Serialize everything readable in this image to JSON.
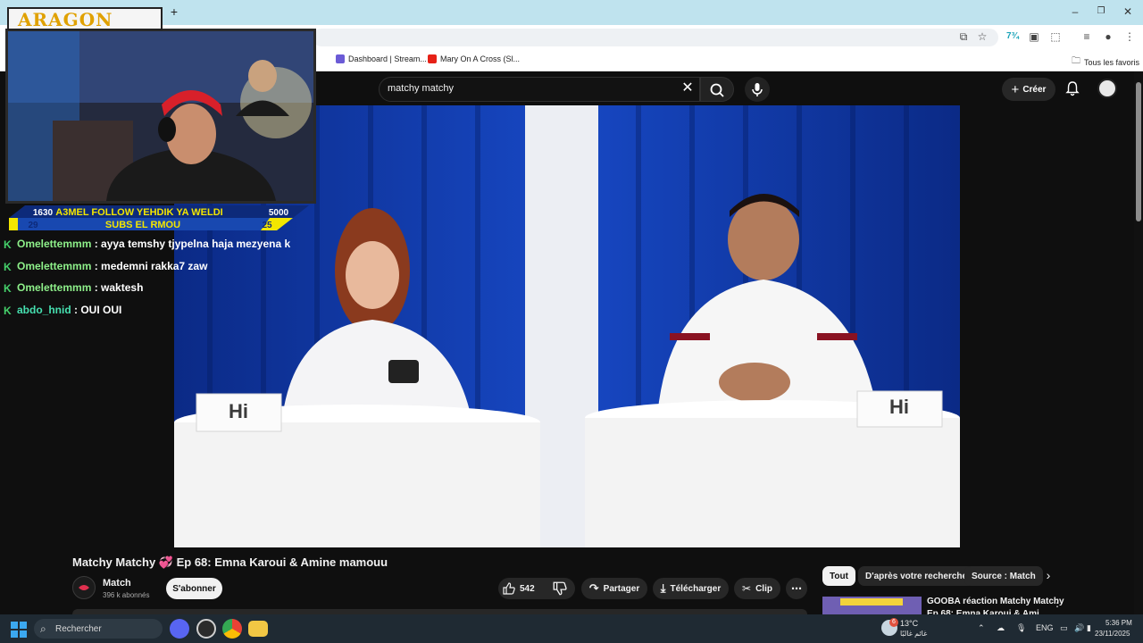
{
  "overlay": {
    "logo": "ARAGON",
    "follow_bar": {
      "left_top": "1630",
      "center_top": "A3MEL FOLLOW YEHDIK YA WELDI",
      "right_top": "5000",
      "left_bottom": "29",
      "center_bottom": "SUBS EL RMOU",
      "right_bottom": "25"
    },
    "chat": [
      {
        "user": "Omelettemmm",
        "message": " : ayya temshy tjypelna haja mezyena k"
      },
      {
        "user": "Omelettemmm",
        "message": " : medemni rakka7 zaw"
      },
      {
        "user": "Omelettemmm",
        "message": " : waktesh"
      },
      {
        "user": "abdo_hnid",
        "message": " : OUI OUI"
      }
    ]
  },
  "browser": {
    "bookmarks": [
      {
        "label": "Dashboard | Stream...",
        "icon": "streamlabs-icon",
        "color": "#6b5bd6"
      },
      {
        "label": "Mary On A Cross (Sl...",
        "icon": "youtube-icon",
        "color": "#e62117"
      }
    ],
    "bookmarks_all": "Tous les favoris",
    "new_tab": "+"
  },
  "youtube": {
    "search_query": "matchy matchy",
    "create_label": "Créer",
    "video_cards": [
      "Hi",
      "Hi"
    ],
    "title": "Matchy Matchy 💞 Ep 68: Emna Karoui & Amine mamouu",
    "channel": {
      "name": "Match",
      "subscribers": "396 k abonnés"
    },
    "subscribe_label": "S'abonner",
    "like_count": "542",
    "share_label": "Partager",
    "download_label": "Télécharger",
    "clip_label": "Clip",
    "chips": [
      "Tout",
      "D'après votre recherche",
      "Source : Match"
    ],
    "recommendation": {
      "title": "GOOBA réaction Matchy Matchy",
      "subtitle": "Ep 68: Emna Karoui & Ami"
    }
  },
  "taskbar": {
    "search_placeholder": "Rechercher",
    "weather_temp": "13°C",
    "weather_desc": "غائم غالبًا",
    "weather_badge": "6",
    "language": "ENG",
    "time": "5:36 PM",
    "date": "23/11/2025"
  }
}
